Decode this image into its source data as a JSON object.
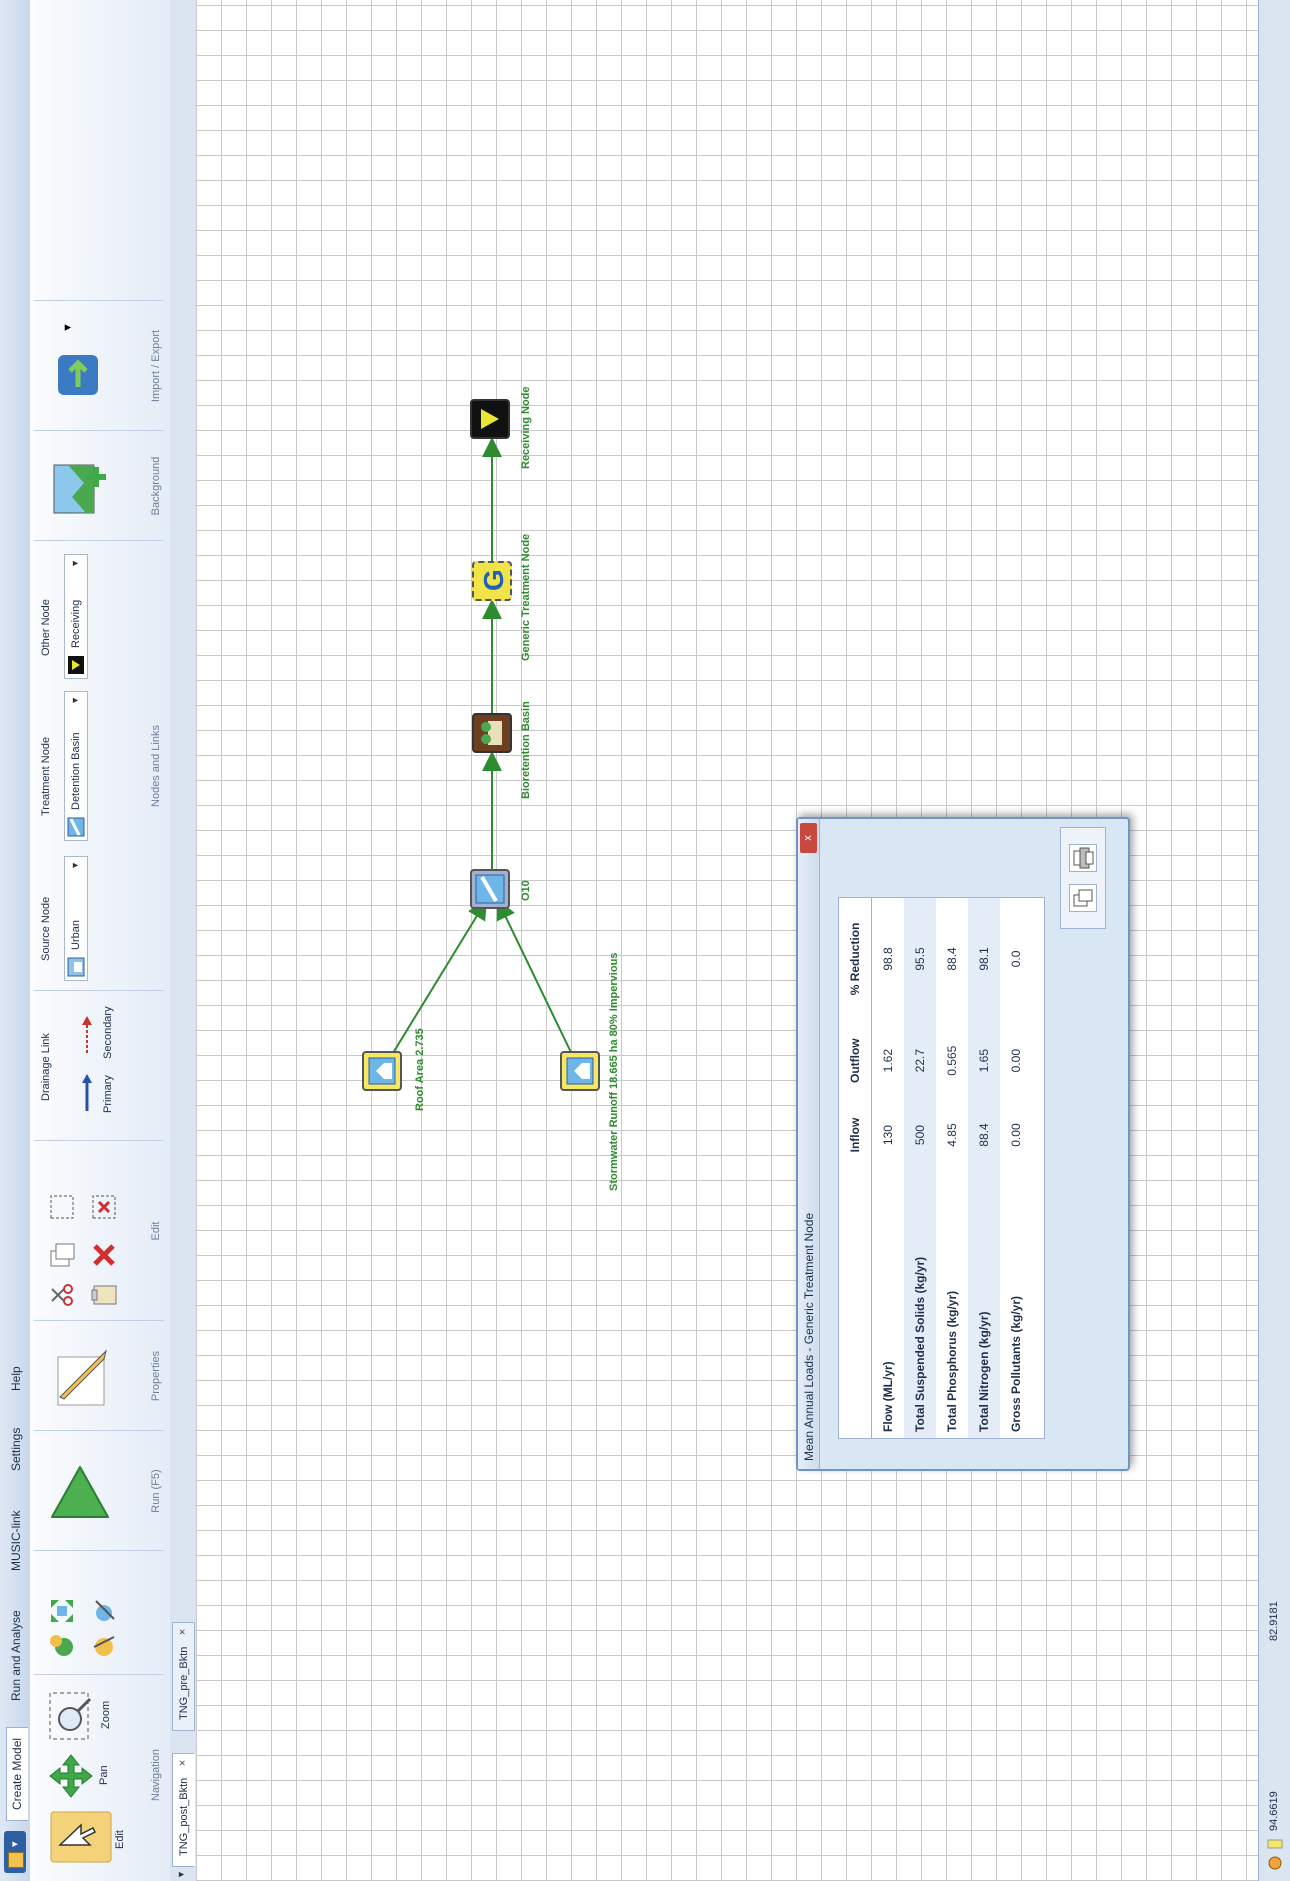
{
  "app": {
    "menu_label": "",
    "tabs": [
      "Create Model",
      "Run and Analyse",
      "MUSIC-link",
      "Settings",
      "Help"
    ]
  },
  "ribbon": {
    "navigation": {
      "title": "Navigation",
      "edit": "Edit",
      "pan": "Pan",
      "zoom": "Zoom"
    },
    "run": {
      "title": "Run (F5)"
    },
    "properties": {
      "title": "Properties"
    },
    "edit_group": {
      "title": "Edit"
    },
    "drainage_link": {
      "header": "Drainage Link",
      "primary": "Primary",
      "secondary": "Secondary"
    },
    "source_node": {
      "header": "Source Node",
      "value": "Urban"
    },
    "treatment_node": {
      "header": "Treatment Node",
      "value": "Detention Basin"
    },
    "other_node": {
      "header": "Other Node",
      "value": "Receiving"
    },
    "nodes_links_title": "Nodes and Links",
    "background_title": "Background",
    "import_export_title": "Import / Export"
  },
  "doc_tabs": [
    {
      "label": "TNG_post_Bktn",
      "close": "×"
    },
    {
      "label": "TNG_pre_Bktn",
      "close": "×"
    }
  ],
  "nodes": {
    "roof": "Roof Area 2.735",
    "stormwater": "Stormwater Runoff 18.665 ha 80% Impervious",
    "o10": "O10",
    "bioretention": "Bioretention Basin",
    "generic": "Generic Treatment Node",
    "receiving": "Receiving Node"
  },
  "status": {
    "x": "94.6619",
    "y": "82.9181"
  },
  "dialog": {
    "title": "Mean Annual Loads - Generic Treatment Node",
    "close": "x",
    "columns": [
      "",
      "Inflow",
      "Outflow",
      "% Reduction"
    ],
    "rows": [
      {
        "name": "Flow (ML/yr)",
        "inflow": "130",
        "outflow": "1.62",
        "reduction": "98.8"
      },
      {
        "name": "Total Suspended Solids (kg/yr)",
        "inflow": "500",
        "outflow": "22.7",
        "reduction": "95.5"
      },
      {
        "name": "Total Phosphorus (kg/yr)",
        "inflow": "4.85",
        "outflow": "0.565",
        "reduction": "88.4"
      },
      {
        "name": "Total Nitrogen (kg/yr)",
        "inflow": "88.4",
        "outflow": "1.65",
        "reduction": "98.1"
      },
      {
        "name": "Gross Pollutants (kg/yr)",
        "inflow": "0.00",
        "outflow": "0.00",
        "reduction": "0.0"
      }
    ]
  },
  "colors": {
    "link": "#2e8b2e",
    "label": "#2e8b2e",
    "accent": "#2f5fa3"
  }
}
